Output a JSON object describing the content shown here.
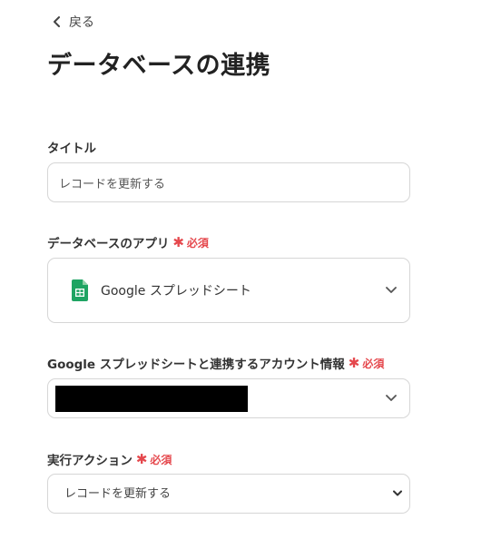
{
  "nav": {
    "back_label": "戻る"
  },
  "page": {
    "title": "データベースの連携"
  },
  "fields": {
    "title": {
      "label": "タイトル",
      "value": "レコードを更新する"
    },
    "database_app": {
      "label": "データベースのアプリ",
      "required_label": "必須",
      "selected": "Google スプレッドシート",
      "icon": "google-sheets-icon"
    },
    "account": {
      "label": "Google スプレッドシートと連携するアカウント情報",
      "required_label": "必須"
    },
    "action": {
      "label": "実行アクション",
      "required_label": "必須",
      "selected": "レコードを更新する"
    }
  },
  "colors": {
    "required": "#e5484d",
    "border": "#d6d6d6",
    "sheets_green": "#1fa463"
  }
}
